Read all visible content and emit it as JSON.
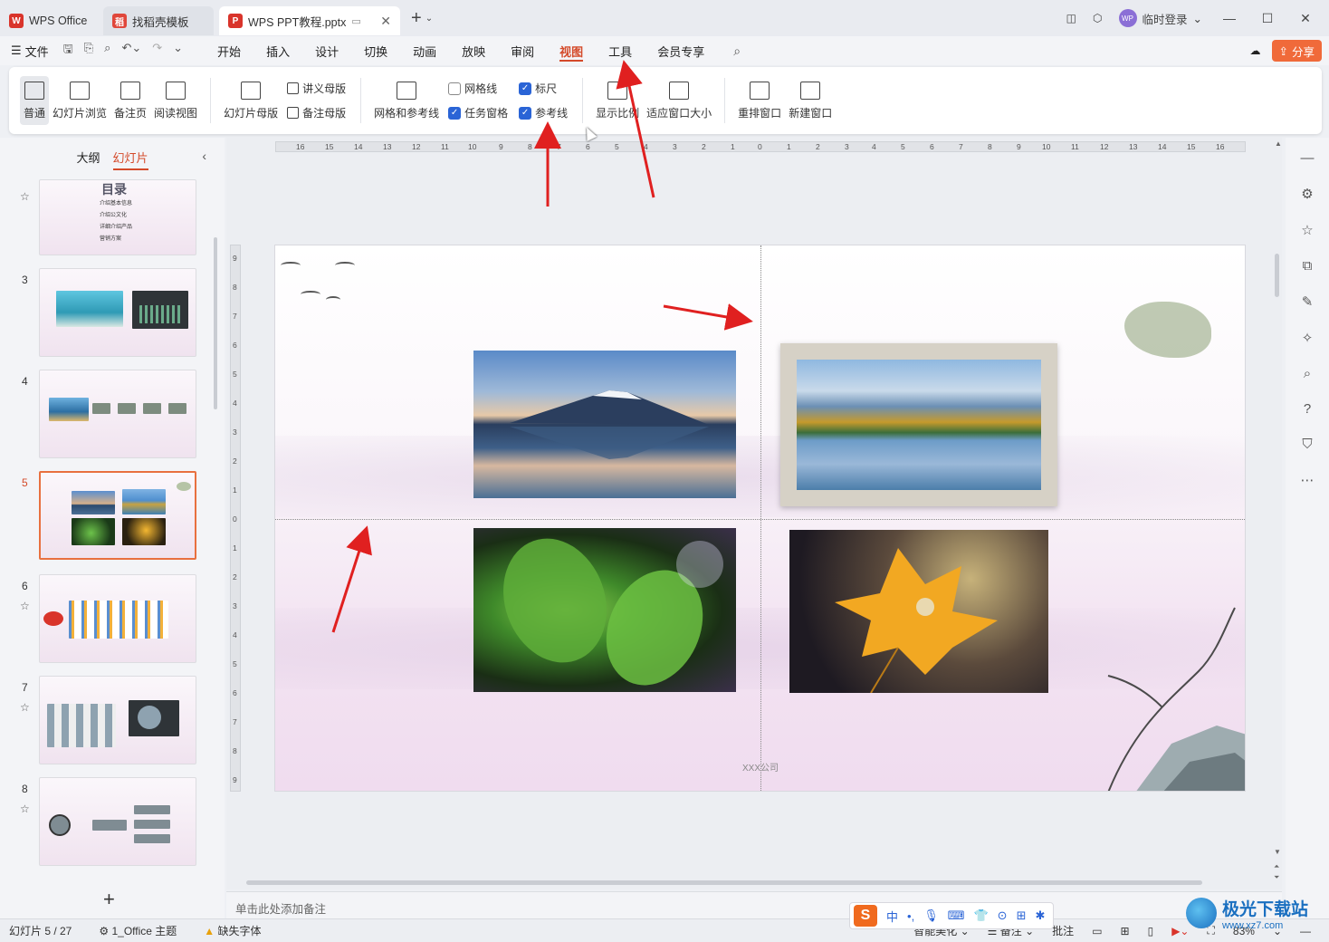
{
  "titlebar": {
    "tabs": [
      {
        "label": "WPS Office",
        "logo": "W",
        "logo_color": "#d9342b"
      },
      {
        "label": "找稻壳模板",
        "logo": "稻",
        "logo_color": "#e0473b"
      },
      {
        "label": "WPS PPT教程.pptx",
        "logo": "P",
        "logo_color": "#d9342b"
      }
    ],
    "login_label": "临时登录",
    "avatar_text": "WP"
  },
  "menubar": {
    "file_label": "文件",
    "items": [
      "开始",
      "插入",
      "设计",
      "切换",
      "动画",
      "放映",
      "审阅",
      "视图",
      "工具",
      "会员专享"
    ],
    "active": "视图",
    "share_label": "分享"
  },
  "ribbon": {
    "view_buttons": [
      "普通",
      "幻灯片浏览",
      "备注页",
      "阅读视图"
    ],
    "master_large": "幻灯片母版",
    "master_small": [
      "讲义母版",
      "备注母版"
    ],
    "grid_large": "网格和参考线",
    "checks_col1": [
      {
        "label": "网格线",
        "checked": false
      },
      {
        "label": "任务窗格",
        "checked": true
      }
    ],
    "checks_col2": [
      {
        "label": "标尺",
        "checked": true
      },
      {
        "label": "参考线",
        "checked": true
      }
    ],
    "zoom_buttons": [
      "显示比例",
      "适应窗口大小"
    ],
    "window_buttons": [
      "重排窗口",
      "新建窗口"
    ]
  },
  "leftpanel": {
    "tabs": [
      "大纲",
      "幻灯片"
    ],
    "active_tab": "幻灯片",
    "slides": [
      {
        "num": "",
        "starred": true,
        "bullets": [
          "介绍基本信息",
          "介绍公文化",
          "详细介绍产品",
          "营销方案"
        ],
        "title": "目录"
      },
      {
        "num": "3",
        "starred": false
      },
      {
        "num": "4",
        "starred": false
      },
      {
        "num": "5",
        "starred": false,
        "current": true
      },
      {
        "num": "6",
        "starred": true
      },
      {
        "num": "7",
        "starred": true
      },
      {
        "num": "8",
        "starred": true
      }
    ]
  },
  "slide": {
    "company": "XXX公司"
  },
  "notes_placeholder": "单击此处添加备注",
  "statusbar": {
    "slide_counter": "幻灯片 5 / 27",
    "theme": "1_Office 主题",
    "missing_font": "缺失字体",
    "smart_beautify": "智能美化",
    "notes": "备注",
    "comments": "批注",
    "zoom": "83%"
  },
  "ime": {
    "logo": "S",
    "mode": "中"
  },
  "watermark": {
    "name": "极光下载站",
    "url": "www.xz7.com"
  },
  "colors": {
    "accent": "#d44a2a",
    "share": "#f06a3a",
    "check": "#2a64d6",
    "annotation_arrow": "#e02020"
  }
}
